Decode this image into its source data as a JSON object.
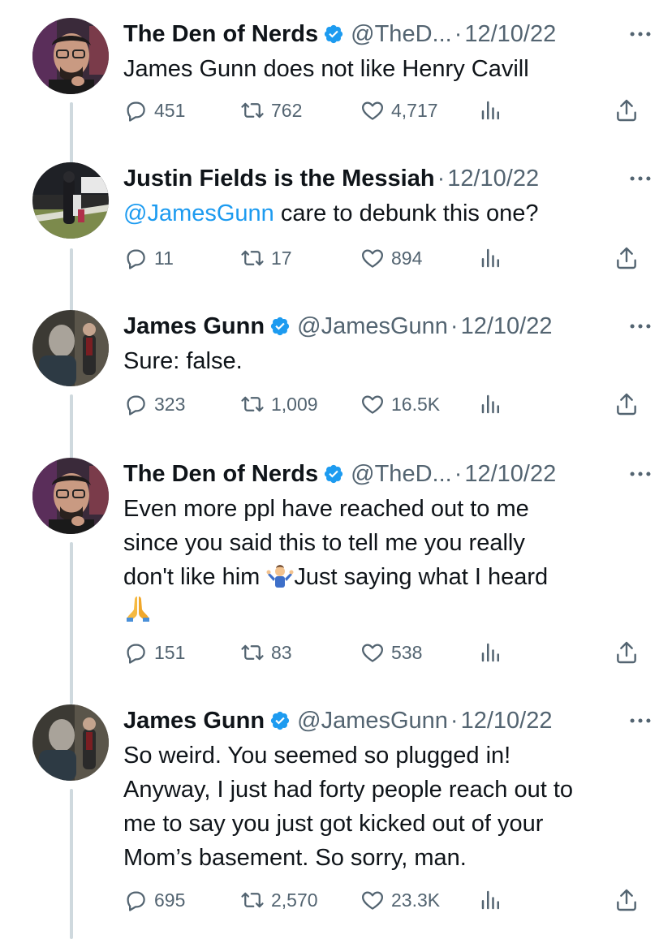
{
  "tweets": [
    {
      "name": "The Den of Nerds",
      "verified": true,
      "handle": "@TheD...",
      "date": "12/10/22",
      "text": "James Gunn does not like Henry Cavill",
      "replies": "451",
      "retweets": "762",
      "likes": "4,717",
      "avatar": "den-of-nerds-avatar"
    },
    {
      "name": "Justin Fields is the Messiah",
      "verified": false,
      "handle": "",
      "date": "12/10/22",
      "mention": "@JamesGunn",
      "text": " care to debunk this one?",
      "replies": "11",
      "retweets": "17",
      "likes": "894",
      "avatar": "justin-fields-avatar"
    },
    {
      "name": "James Gunn",
      "verified": true,
      "handle": "@JamesGunn",
      "date": "12/10/22",
      "text": "Sure: false.",
      "replies": "323",
      "retweets": "1,009",
      "likes": "16.5K",
      "avatar": "james-gunn-avatar"
    },
    {
      "name": "The Den of Nerds",
      "verified": true,
      "handle": "@TheD...",
      "date": "12/10/22",
      "text_lines": [
        "Even more ppl have reached out to me",
        "since you said this to tell me you really",
        "don't like him ",
        "Just saying what I heard"
      ],
      "emojis": [
        "person-shrugging",
        "folded-hands"
      ],
      "replies": "151",
      "retweets": "83",
      "likes": "538",
      "avatar": "den-of-nerds-avatar"
    },
    {
      "name": "James Gunn",
      "verified": true,
      "handle": "@JamesGunn",
      "date": "12/10/22",
      "text_lines": [
        "So weird. You seemed so plugged in!",
        "Anyway, I just had forty people reach out to",
        "me to say you just got kicked out of your",
        "Mom’s basement. So sorry, man."
      ],
      "replies": "695",
      "retweets": "2,570",
      "likes": "23.3K",
      "avatar": "james-gunn-avatar"
    }
  ],
  "separator": "·",
  "colors": {
    "text": "#0f1419",
    "secondary": "#536471",
    "link": "#1d9bf0",
    "thread": "#cfd9de",
    "verified": "#1d9bf0"
  }
}
